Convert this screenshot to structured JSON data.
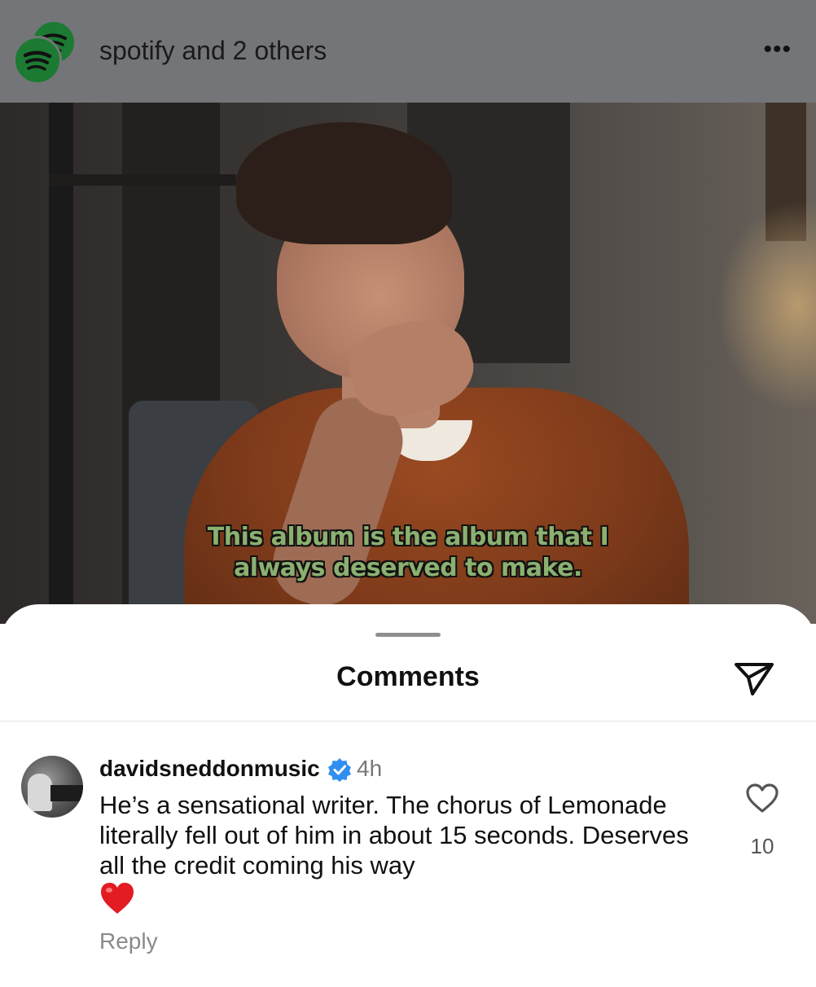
{
  "header": {
    "title": "spotify and 2 others",
    "avatar_icon": "spotify-logo-icon",
    "more_icon": "more-horizontal-icon",
    "background": "#747578",
    "brand_color": "#1c7a33"
  },
  "video": {
    "subtitle_line1": "This album is the album that I",
    "subtitle_line2": "always deserved to make.",
    "subtitle_color": "#8bb070"
  },
  "comments_sheet": {
    "title": "Comments",
    "share_icon": "paper-plane-icon",
    "comments": [
      {
        "username": "davidsneddonmusic",
        "verified": true,
        "time": "4h",
        "text": "He’s a sensational writer. The chorus of Lemonade literally fell out of him in about 15 seconds. Deserves all the credit coming his way",
        "emoji": "❤️",
        "reply_label": "Reply",
        "like_count": "10",
        "like_icon": "heart-outline-icon"
      }
    ]
  }
}
